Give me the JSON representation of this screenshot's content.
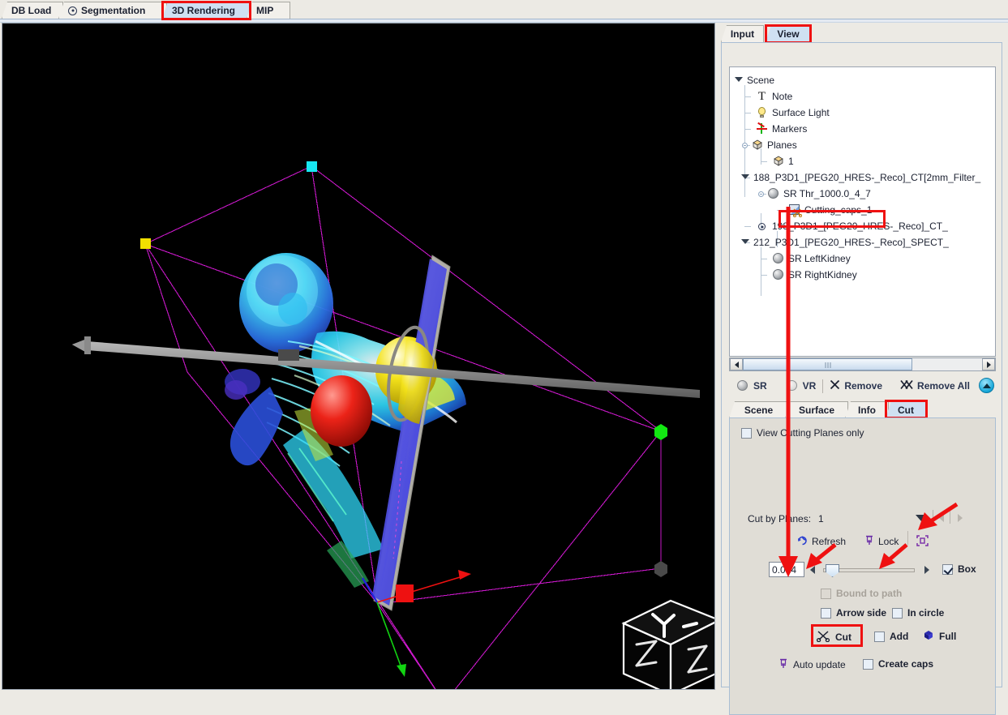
{
  "window": {
    "top_tabs": [
      {
        "label": "DB Load",
        "icon": "",
        "selected": false
      },
      {
        "label": "Segmentation",
        "icon": "target-icon",
        "selected": false
      },
      {
        "label": "3D Rendering",
        "icon": "",
        "selected": true,
        "highlighted": true
      },
      {
        "label": "MIP",
        "icon": "",
        "selected": false
      }
    ]
  },
  "dock": {
    "tabs": [
      {
        "label": "Input",
        "selected": false
      },
      {
        "label": "View",
        "selected": true,
        "highlighted": true
      }
    ],
    "tree": [
      {
        "label": "Scene",
        "icon": "none",
        "depth": 0,
        "toggle": "caret"
      },
      {
        "label": "Note",
        "icon": "note-icon",
        "depth": 1,
        "toggle": "none"
      },
      {
        "label": "Surface Light",
        "icon": "bulb-icon",
        "depth": 1,
        "toggle": "none"
      },
      {
        "label": "Markers",
        "icon": "markers-icon",
        "depth": 1,
        "toggle": "none"
      },
      {
        "label": "Planes",
        "icon": "cube-icon",
        "depth": 1,
        "toggle": "knob"
      },
      {
        "label": "1",
        "icon": "cube-icon",
        "depth": 2,
        "toggle": "none"
      },
      {
        "label": "188_P3D1_[PEG20_HRES-_Reco]_CT[2mm_Filter_",
        "icon": "none",
        "depth": 1,
        "toggle": "caret"
      },
      {
        "label": "SR Thr_1000.0_4_7",
        "icon": "sphere-icon",
        "depth": 2,
        "toggle": "knob"
      },
      {
        "label": "Cutting_caps_1",
        "icon": "cutting-caps-icon",
        "depth": 3,
        "toggle": "none",
        "highlighted": true
      },
      {
        "label": "198_P3D1_[PEG20_HRES-_Reco]_CT_",
        "icon": "target-icon",
        "depth": 1,
        "toggle": "none"
      },
      {
        "label": "212_P3D1_[PEG20_HRES-_Reco]_SPECT_",
        "icon": "none",
        "depth": 1,
        "toggle": "caret"
      },
      {
        "label": "SR LeftKidney",
        "icon": "sphere-icon",
        "depth": 2,
        "toggle": "none"
      },
      {
        "label": "SR RightKidney",
        "icon": "sphere-icon",
        "depth": 2,
        "toggle": "none"
      }
    ],
    "actions": [
      {
        "label": "SR",
        "icon": "sphere-icon"
      },
      {
        "label": "VR",
        "icon": "sphere-outline-icon"
      },
      {
        "label": "Remove",
        "icon": "x-icon"
      },
      {
        "label": "Remove All",
        "icon": "double-x-icon"
      }
    ],
    "collapse_icon": "collapse-up-icon",
    "sub_tabs": [
      {
        "label": "Scene",
        "selected": false
      },
      {
        "label": "Surface",
        "selected": false
      },
      {
        "label": "Info",
        "selected": false
      },
      {
        "label": "Cut",
        "selected": true,
        "highlighted": true
      }
    ]
  },
  "cut_panel": {
    "view_cutting_planes_only": {
      "label": "View Cutting Planes only",
      "checked": false
    },
    "cut_by_planes": {
      "label": "Cut by Planes:",
      "value": "1"
    },
    "refresh": {
      "label": "Refresh",
      "icon": "refresh-icon"
    },
    "lock": {
      "label": "Lock",
      "icon": "pin-icon"
    },
    "fit": {
      "icon": "fit-bounds-icon"
    },
    "thickness_value": "0.014",
    "box": {
      "label": "Box",
      "checked": true
    },
    "bound_to_path": {
      "label": "Bound to path",
      "checked": false,
      "disabled": true
    },
    "arrow_side": {
      "label": "Arrow side",
      "checked": false
    },
    "in_circle": {
      "label": "In circle",
      "checked": false
    },
    "cut": {
      "label": "Cut",
      "icon": "scissors-icon",
      "highlighted": true
    },
    "add": {
      "label": "Add",
      "checked": false
    },
    "full": {
      "label": "Full",
      "icon": "cube-solid-icon"
    },
    "auto_update": {
      "label": "Auto update",
      "icon": "pin-icon"
    },
    "create_caps": {
      "label": "Create caps",
      "checked": false
    }
  },
  "viewport": {
    "orientation_cube_label": "Y-",
    "background": "#000000",
    "bbox_color": "#c818c8",
    "handle_colors": {
      "top": "#17e7f2",
      "left": "#f2e000",
      "right": "#12e812",
      "front": "#ee1111",
      "back": "#5a5a5a"
    },
    "plane_color": "#4a4ae0",
    "axis_colors": {
      "x": "#ee1111",
      "y": "#12d412",
      "z": "#2222dd"
    }
  },
  "annotations": {
    "color": "#ef1111",
    "arrow_count": 5
  }
}
